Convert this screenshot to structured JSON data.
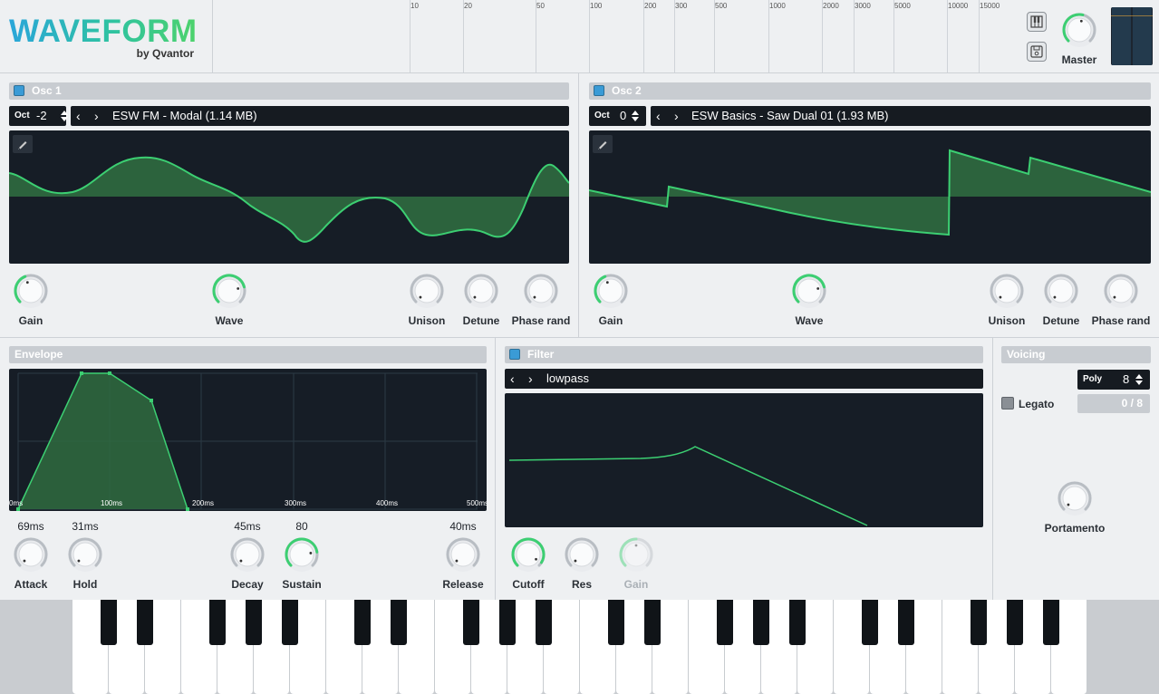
{
  "header": {
    "logo_title": "WAVEFORM",
    "logo_by": "by Qvantor",
    "freq_labels": [
      "10",
      "20",
      "50",
      "100",
      "200",
      "300",
      "500",
      "1000",
      "2000",
      "3000",
      "5000",
      "10000",
      "15000"
    ],
    "keyboard_icon": "piano-keys-icon",
    "save_icon": "save-disk-icon",
    "master_label": "Master"
  },
  "osc1": {
    "title": "Osc 1",
    "oct_label": "Oct",
    "oct_value": "-2",
    "preset": "ESW FM - Modal (1.14 MB)",
    "knobs": {
      "gain": "Gain",
      "wave": "Wave",
      "unison": "Unison",
      "detune": "Detune",
      "phase": "Phase rand"
    }
  },
  "osc2": {
    "title": "Osc 2",
    "oct_label": "Oct",
    "oct_value": "0",
    "preset": "ESW Basics - Saw Dual 01 (1.93 MB)",
    "knobs": {
      "gain": "Gain",
      "wave": "Wave",
      "unison": "Unison",
      "detune": "Detune",
      "phase": "Phase rand"
    }
  },
  "envelope": {
    "title": "Envelope",
    "time_ticks": [
      "0ms",
      "100ms",
      "200ms",
      "300ms",
      "400ms",
      "500ms"
    ],
    "attack": {
      "label": "Attack",
      "value": "69ms"
    },
    "hold": {
      "label": "Hold",
      "value": "31ms"
    },
    "decay": {
      "label": "Decay",
      "value": "45ms"
    },
    "sustain": {
      "label": "Sustain",
      "value": "80"
    },
    "release": {
      "label": "Release",
      "value": "40ms"
    }
  },
  "filter": {
    "title": "Filter",
    "type": "lowpass",
    "knobs": {
      "cutoff": "Cutoff",
      "res": "Res",
      "gain": "Gain"
    }
  },
  "voicing": {
    "title": "Voicing",
    "mode": "Poly",
    "voices": "8",
    "legato": "Legato",
    "active": "0 / 8",
    "portamento": "Portamento"
  },
  "colors": {
    "accent": "#3ccf72",
    "checkbox": "#3a9bd6",
    "screen": "#161d26"
  }
}
